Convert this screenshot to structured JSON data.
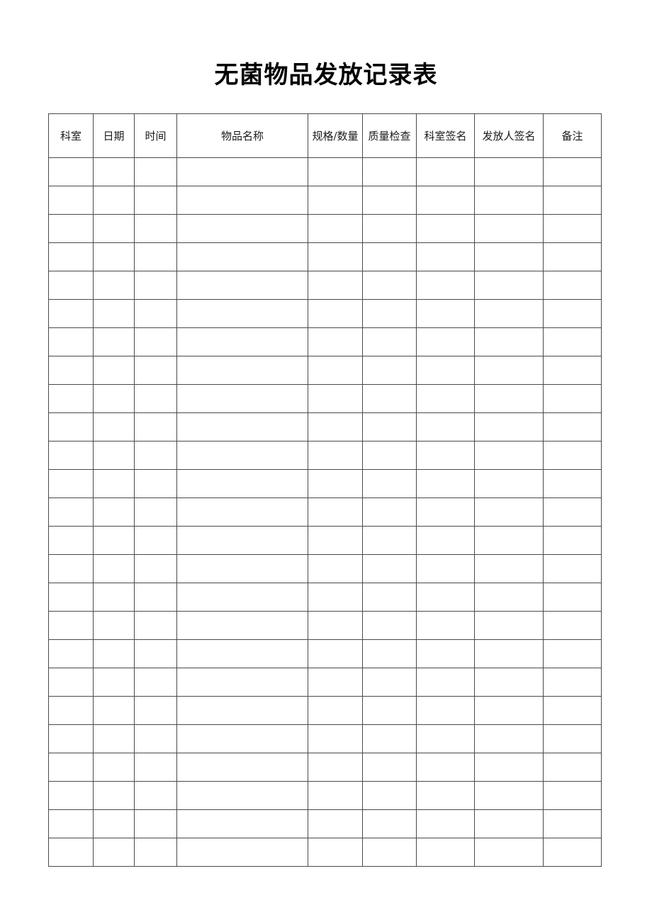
{
  "document": {
    "title": "无菌物品发放记录表"
  },
  "table": {
    "columns": [
      {
        "key": "department",
        "label": "科室",
        "wrap": false
      },
      {
        "key": "date",
        "label": "日期",
        "wrap": false
      },
      {
        "key": "time",
        "label": "时间",
        "wrap": false
      },
      {
        "key": "item_name",
        "label": "物品名称",
        "wrap": false
      },
      {
        "key": "spec_quantity",
        "label": "规格/数量",
        "wrap": true
      },
      {
        "key": "quality_check",
        "label": "质量检查",
        "wrap": true
      },
      {
        "key": "department_sign",
        "label": "科室签名",
        "wrap": true
      },
      {
        "key": "issuer_sign",
        "label": "发放人签名",
        "wrap": true
      },
      {
        "key": "remarks",
        "label": "备注",
        "wrap": false
      }
    ],
    "row_count": 25,
    "rows": [
      {
        "department": "",
        "date": "",
        "time": "",
        "item_name": "",
        "spec_quantity": "",
        "quality_check": "",
        "department_sign": "",
        "issuer_sign": "",
        "remarks": ""
      },
      {
        "department": "",
        "date": "",
        "time": "",
        "item_name": "",
        "spec_quantity": "",
        "quality_check": "",
        "department_sign": "",
        "issuer_sign": "",
        "remarks": ""
      },
      {
        "department": "",
        "date": "",
        "time": "",
        "item_name": "",
        "spec_quantity": "",
        "quality_check": "",
        "department_sign": "",
        "issuer_sign": "",
        "remarks": ""
      },
      {
        "department": "",
        "date": "",
        "time": "",
        "item_name": "",
        "spec_quantity": "",
        "quality_check": "",
        "department_sign": "",
        "issuer_sign": "",
        "remarks": ""
      },
      {
        "department": "",
        "date": "",
        "time": "",
        "item_name": "",
        "spec_quantity": "",
        "quality_check": "",
        "department_sign": "",
        "issuer_sign": "",
        "remarks": ""
      },
      {
        "department": "",
        "date": "",
        "time": "",
        "item_name": "",
        "spec_quantity": "",
        "quality_check": "",
        "department_sign": "",
        "issuer_sign": "",
        "remarks": ""
      },
      {
        "department": "",
        "date": "",
        "time": "",
        "item_name": "",
        "spec_quantity": "",
        "quality_check": "",
        "department_sign": "",
        "issuer_sign": "",
        "remarks": ""
      },
      {
        "department": "",
        "date": "",
        "time": "",
        "item_name": "",
        "spec_quantity": "",
        "quality_check": "",
        "department_sign": "",
        "issuer_sign": "",
        "remarks": ""
      },
      {
        "department": "",
        "date": "",
        "time": "",
        "item_name": "",
        "spec_quantity": "",
        "quality_check": "",
        "department_sign": "",
        "issuer_sign": "",
        "remarks": ""
      },
      {
        "department": "",
        "date": "",
        "time": "",
        "item_name": "",
        "spec_quantity": "",
        "quality_check": "",
        "department_sign": "",
        "issuer_sign": "",
        "remarks": ""
      },
      {
        "department": "",
        "date": "",
        "time": "",
        "item_name": "",
        "spec_quantity": "",
        "quality_check": "",
        "department_sign": "",
        "issuer_sign": "",
        "remarks": ""
      },
      {
        "department": "",
        "date": "",
        "time": "",
        "item_name": "",
        "spec_quantity": "",
        "quality_check": "",
        "department_sign": "",
        "issuer_sign": "",
        "remarks": ""
      },
      {
        "department": "",
        "date": "",
        "time": "",
        "item_name": "",
        "spec_quantity": "",
        "quality_check": "",
        "department_sign": "",
        "issuer_sign": "",
        "remarks": ""
      },
      {
        "department": "",
        "date": "",
        "time": "",
        "item_name": "",
        "spec_quantity": "",
        "quality_check": "",
        "department_sign": "",
        "issuer_sign": "",
        "remarks": ""
      },
      {
        "department": "",
        "date": "",
        "time": "",
        "item_name": "",
        "spec_quantity": "",
        "quality_check": "",
        "department_sign": "",
        "issuer_sign": "",
        "remarks": ""
      },
      {
        "department": "",
        "date": "",
        "time": "",
        "item_name": "",
        "spec_quantity": "",
        "quality_check": "",
        "department_sign": "",
        "issuer_sign": "",
        "remarks": ""
      },
      {
        "department": "",
        "date": "",
        "time": "",
        "item_name": "",
        "spec_quantity": "",
        "quality_check": "",
        "department_sign": "",
        "issuer_sign": "",
        "remarks": ""
      },
      {
        "department": "",
        "date": "",
        "time": "",
        "item_name": "",
        "spec_quantity": "",
        "quality_check": "",
        "department_sign": "",
        "issuer_sign": "",
        "remarks": ""
      },
      {
        "department": "",
        "date": "",
        "time": "",
        "item_name": "",
        "spec_quantity": "",
        "quality_check": "",
        "department_sign": "",
        "issuer_sign": "",
        "remarks": ""
      },
      {
        "department": "",
        "date": "",
        "time": "",
        "item_name": "",
        "spec_quantity": "",
        "quality_check": "",
        "department_sign": "",
        "issuer_sign": "",
        "remarks": ""
      },
      {
        "department": "",
        "date": "",
        "time": "",
        "item_name": "",
        "spec_quantity": "",
        "quality_check": "",
        "department_sign": "",
        "issuer_sign": "",
        "remarks": ""
      },
      {
        "department": "",
        "date": "",
        "time": "",
        "item_name": "",
        "spec_quantity": "",
        "quality_check": "",
        "department_sign": "",
        "issuer_sign": "",
        "remarks": ""
      },
      {
        "department": "",
        "date": "",
        "time": "",
        "item_name": "",
        "spec_quantity": "",
        "quality_check": "",
        "department_sign": "",
        "issuer_sign": "",
        "remarks": ""
      },
      {
        "department": "",
        "date": "",
        "time": "",
        "item_name": "",
        "spec_quantity": "",
        "quality_check": "",
        "department_sign": "",
        "issuer_sign": "",
        "remarks": ""
      },
      {
        "department": "",
        "date": "",
        "time": "",
        "item_name": "",
        "spec_quantity": "",
        "quality_check": "",
        "department_sign": "",
        "issuer_sign": "",
        "remarks": ""
      }
    ]
  },
  "colors": {
    "text": "#000000",
    "border": "#4a4a4a",
    "border_outer": "#808080",
    "background": "#ffffff"
  }
}
